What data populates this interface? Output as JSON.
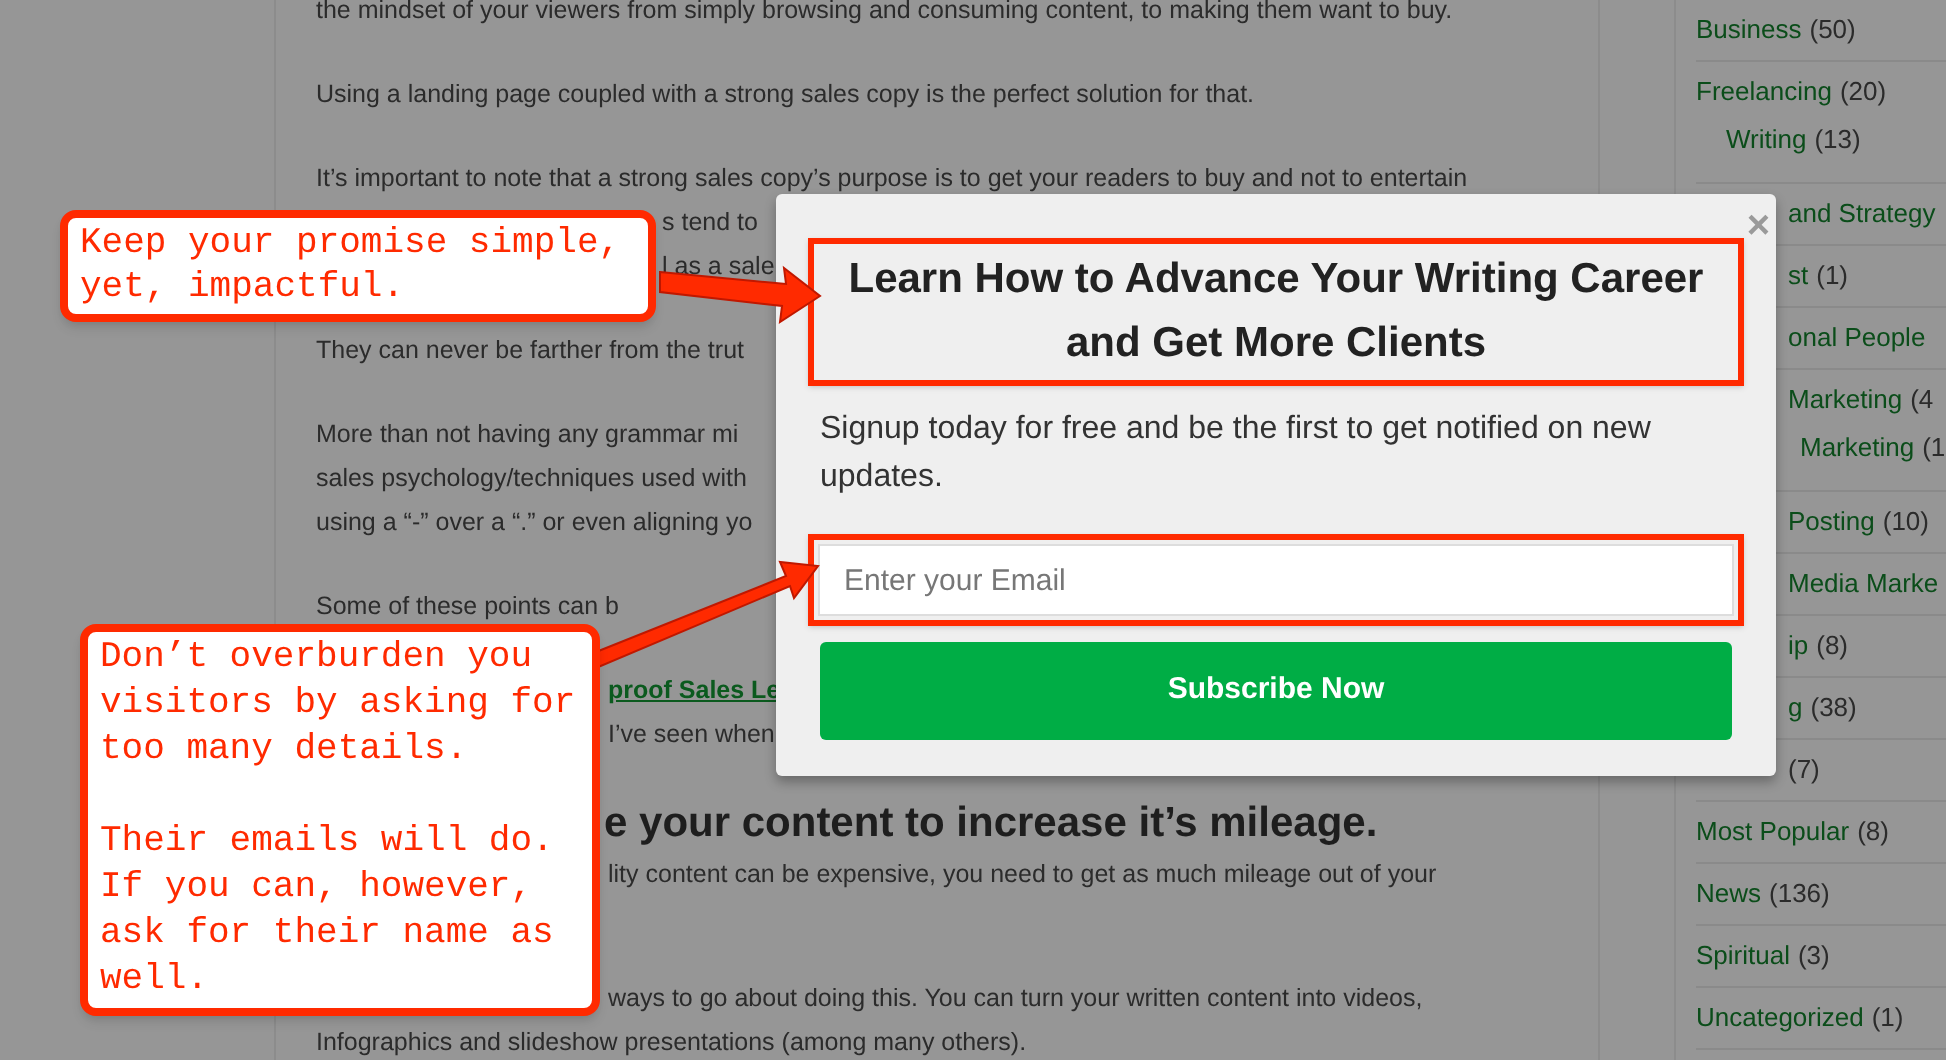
{
  "article": {
    "paragraphs": [
      {
        "lines": [
          {
            "kind": "full",
            "text": "the mindset of your viewers from simply browsing and consuming content, to making them want to buy."
          }
        ]
      },
      {
        "lines": [
          {
            "kind": "full",
            "text": "Using a landing page coupled with a strong sales copy is the perfect solution for that."
          }
        ]
      },
      {
        "lines": [
          {
            "kind": "full",
            "text": "It’s important to note that a strong sales copy’s purpose is to get your readers to buy and not to entertain"
          },
          {
            "kind": "beside_top_note",
            "text": "s tend to"
          },
          {
            "kind": "beside_top_note",
            "text": "l as a sale"
          }
        ]
      },
      {
        "lines": [
          {
            "kind": "full",
            "text": "They can never be farther from the trut"
          }
        ]
      },
      {
        "lines": [
          {
            "kind": "full",
            "text": "More than not having any grammar mi"
          },
          {
            "kind": "full",
            "text": "sales psychology/techniques used with"
          },
          {
            "kind": "full",
            "text": "using a “-” over a “.” or even aligning yo"
          }
        ]
      },
      {
        "lines": [
          {
            "kind": "full",
            "text": "Some of these points can b"
          }
        ]
      },
      {
        "lines": [
          {
            "kind": "link",
            "text": "proof Sales Le"
          },
          {
            "kind": "beside_note",
            "text": "I’ve seen when"
          }
        ]
      },
      {
        "lines": [
          {
            "kind": "heading",
            "text": "e your content to increase it’s mileage."
          },
          {
            "kind": "beside_note",
            "text": "lity content can be expensive, you need to get as much mileage out of your"
          }
        ]
      },
      {
        "lines": [
          {
            "kind": "beside_note",
            "text": "ways to go about doing this. You can turn your written content into videos,"
          },
          {
            "kind": "full",
            "text": "Infographics and slideshow presentations (among many others)."
          }
        ]
      }
    ]
  },
  "sidebar": {
    "items": [
      {
        "kind": "full",
        "name": "Business",
        "count": "(50)"
      },
      {
        "kind": "full",
        "name": "Freelancing",
        "count": "(20)",
        "children": [
          {
            "kind": "full",
            "name": "Writing",
            "count": "(13)"
          }
        ]
      },
      {
        "kind": "cut",
        "name": "and Strategy"
      },
      {
        "kind": "cut",
        "name": "st",
        "count": "(1)"
      },
      {
        "kind": "cut",
        "name": "onal People"
      },
      {
        "kind": "cut",
        "name": "Marketing",
        "count": "(4",
        "children": [
          {
            "kind": "cut",
            "name": "Marketing",
            "count": "(1"
          }
        ]
      },
      {
        "kind": "cut",
        "name": "Posting",
        "count": "(10)"
      },
      {
        "kind": "cut",
        "name": "Media Marke"
      },
      {
        "kind": "cut",
        "name": "ip",
        "count": "(8)"
      },
      {
        "kind": "cut",
        "name": "g",
        "count": "(38)"
      },
      {
        "kind": "cut",
        "count": "(7)"
      },
      {
        "kind": "full",
        "name": "Most Popular",
        "count": "(8)"
      },
      {
        "kind": "full",
        "name": "News",
        "count": "(136)"
      },
      {
        "kind": "full",
        "name": "Spiritual",
        "count": "(3)"
      },
      {
        "kind": "full",
        "name": "Uncategorized",
        "count": "(1)"
      }
    ]
  },
  "popup": {
    "close": "×",
    "title": "Learn How to Advance Your Writing Career and Get More Clients",
    "subtitle": "Signup today for free and be the first to get notified on new updates.",
    "email": {
      "placeholder": "Enter your Email"
    },
    "button": "Subscribe Now"
  },
  "annotations": [
    {
      "text": "Keep your promise simple, yet, impactful."
    },
    {
      "text": "Don’t overburden you visitors by asking for too many details.",
      "note": "Their emails will do. If you can, however, ask for their name as well."
    }
  ]
}
